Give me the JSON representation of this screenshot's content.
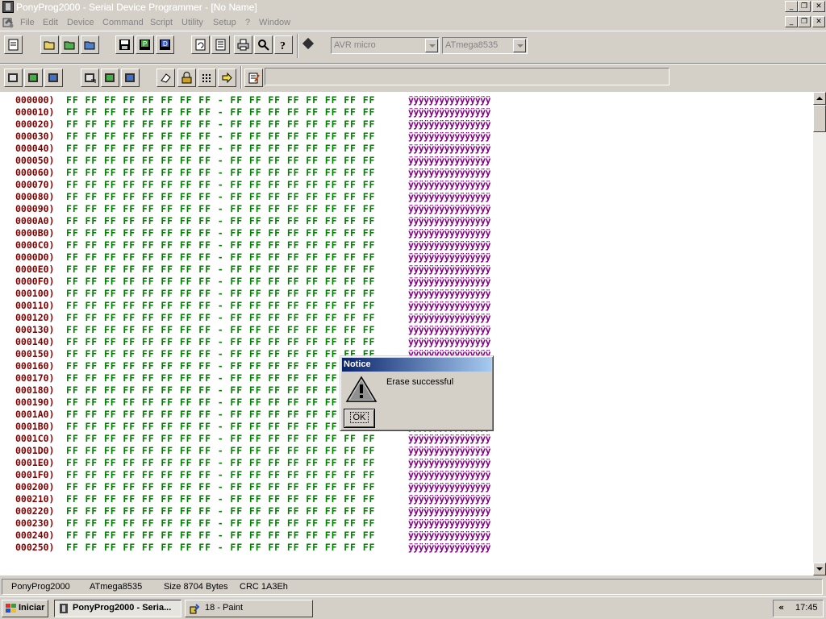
{
  "window": {
    "title": "PonyProg2000 - Serial Device Programmer - [No Name]",
    "title_controls": [
      "_",
      "❐",
      "✕"
    ],
    "doc_controls": [
      "_",
      "❐",
      "✕"
    ]
  },
  "menu": [
    "File",
    "Edit",
    "Device",
    "Command",
    "Script",
    "Utility",
    "Setup",
    "?",
    "Window"
  ],
  "toolbar1": {
    "buttons": [
      "new-icon",
      "open-icon",
      "open-program-icon",
      "open-data-icon",
      "save-icon",
      "save-program-icon",
      "save-data-icon",
      "reload-icon",
      "edit-icon",
      "print-icon",
      "setup-icon",
      "help-icon"
    ],
    "device_family": "AVR micro",
    "device_type": "ATmega8535"
  },
  "toolbar2": {
    "buttons": [
      "read-all-icon",
      "read-program-icon",
      "read-data-icon",
      "write-all-icon",
      "write-program-icon",
      "write-data-icon",
      "erase-icon",
      "security-icon",
      "config-icon",
      "next-icon",
      "script-edit-icon"
    ],
    "script_field": ""
  },
  "hexdump": {
    "byte_value": "FF",
    "ascii_text": "ÿÿÿÿÿÿÿÿÿÿÿÿÿÿÿÿ",
    "rows": [
      {
        "addr": "000000)"
      },
      {
        "addr": "000010)"
      },
      {
        "addr": "000020)"
      },
      {
        "addr": "000030)"
      },
      {
        "addr": "000040)"
      },
      {
        "addr": "000050)"
      },
      {
        "addr": "000060)"
      },
      {
        "addr": "000070)"
      },
      {
        "addr": "000080)"
      },
      {
        "addr": "000090)"
      },
      {
        "addr": "0000A0)"
      },
      {
        "addr": "0000B0)"
      },
      {
        "addr": "0000C0)"
      },
      {
        "addr": "0000D0)"
      },
      {
        "addr": "0000E0)"
      },
      {
        "addr": "0000F0)"
      },
      {
        "addr": "000100)"
      },
      {
        "addr": "000110)"
      },
      {
        "addr": "000120)"
      },
      {
        "addr": "000130)"
      },
      {
        "addr": "000140)"
      },
      {
        "addr": "000150)"
      },
      {
        "addr": "000160)"
      },
      {
        "addr": "000170)"
      },
      {
        "addr": "000180)"
      },
      {
        "addr": "000190)"
      },
      {
        "addr": "0001A0)"
      },
      {
        "addr": "0001B0)"
      },
      {
        "addr": "0001C0)"
      },
      {
        "addr": "0001D0)"
      },
      {
        "addr": "0001E0)"
      },
      {
        "addr": "0001F0)"
      },
      {
        "addr": "000200)"
      },
      {
        "addr": "000210)"
      },
      {
        "addr": "000220)"
      },
      {
        "addr": "000230)"
      },
      {
        "addr": "000240)"
      },
      {
        "addr": "000250)"
      }
    ]
  },
  "statusbar": {
    "app": "PonyProg2000",
    "device": "ATmega8535",
    "size": "Size  8704 Bytes",
    "crc": "CRC  1A3Eh"
  },
  "dialog": {
    "title": "Notice",
    "message": "Erase successful",
    "ok_label": "OK"
  },
  "taskbar": {
    "start_label": "Iniciar",
    "tasks": [
      {
        "label": "PonyProg2000 - Seria...",
        "active": true
      },
      {
        "label": "18 - Paint",
        "active": false
      }
    ],
    "tray_toggle": "«",
    "clock": "17:45"
  }
}
